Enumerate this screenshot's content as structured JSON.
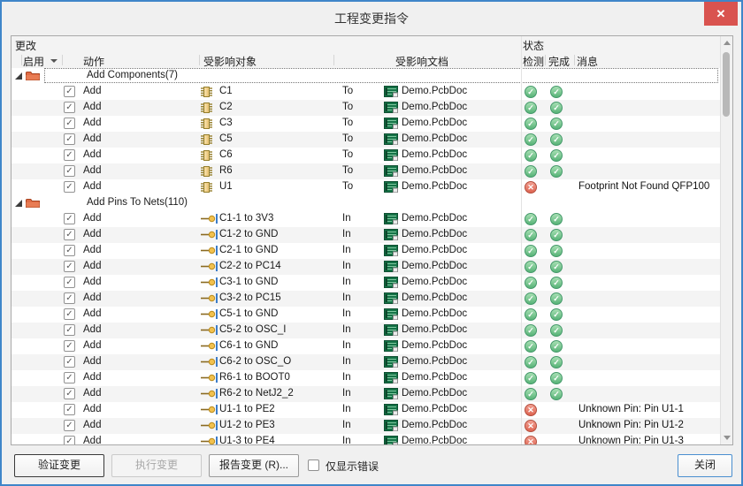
{
  "dialog": {
    "title": "工程变更指令"
  },
  "titlebar": {
    "close_glyph": "✕"
  },
  "symbols": {
    "ok": "✓",
    "error": "✕",
    "checkbox_check": "✓"
  },
  "colors": {
    "accent_border": "#3f86c9",
    "close_red": "#d9534f",
    "ok_green": "#57b377",
    "error_red": "#de6451",
    "folder_orange": "#e06a44",
    "chip_yellow": "#ecc97f",
    "doc_green": "#157347"
  },
  "table": {
    "band_changes": "更改",
    "band_status": "状态",
    "col_enable": "启用",
    "col_action": "动作",
    "col_object": "受影响对象",
    "col_document": "受影响文档",
    "col_check": "检测",
    "col_done": "完成",
    "col_message": "消息",
    "groups": [
      {
        "label": "Add Components(7)",
        "focused": true,
        "icon": "component",
        "rows": [
          {
            "enabled": true,
            "action": "Add",
            "object": "C1",
            "prep": "To",
            "doc": "Demo.PcbDoc",
            "check": "ok",
            "done": "ok",
            "message": ""
          },
          {
            "enabled": true,
            "action": "Add",
            "object": "C2",
            "prep": "To",
            "doc": "Demo.PcbDoc",
            "check": "ok",
            "done": "ok",
            "message": ""
          },
          {
            "enabled": true,
            "action": "Add",
            "object": "C3",
            "prep": "To",
            "doc": "Demo.PcbDoc",
            "check": "ok",
            "done": "ok",
            "message": ""
          },
          {
            "enabled": true,
            "action": "Add",
            "object": "C5",
            "prep": "To",
            "doc": "Demo.PcbDoc",
            "check": "ok",
            "done": "ok",
            "message": ""
          },
          {
            "enabled": true,
            "action": "Add",
            "object": "C6",
            "prep": "To",
            "doc": "Demo.PcbDoc",
            "check": "ok",
            "done": "ok",
            "message": ""
          },
          {
            "enabled": true,
            "action": "Add",
            "object": "R6",
            "prep": "To",
            "doc": "Demo.PcbDoc",
            "check": "ok",
            "done": "ok",
            "message": ""
          },
          {
            "enabled": true,
            "action": "Add",
            "object": "U1",
            "prep": "To",
            "doc": "Demo.PcbDoc",
            "check": "error",
            "done": "none",
            "message": "Footprint Not Found QFP100"
          }
        ]
      },
      {
        "label": "Add Pins To Nets(110)",
        "focused": false,
        "icon": "pin",
        "rows": [
          {
            "enabled": true,
            "action": "Add",
            "object": "C1-1 to 3V3",
            "prep": "In",
            "doc": "Demo.PcbDoc",
            "check": "ok",
            "done": "ok",
            "message": ""
          },
          {
            "enabled": true,
            "action": "Add",
            "object": "C1-2 to GND",
            "prep": "In",
            "doc": "Demo.PcbDoc",
            "check": "ok",
            "done": "ok",
            "message": ""
          },
          {
            "enabled": true,
            "action": "Add",
            "object": "C2-1 to GND",
            "prep": "In",
            "doc": "Demo.PcbDoc",
            "check": "ok",
            "done": "ok",
            "message": ""
          },
          {
            "enabled": true,
            "action": "Add",
            "object": "C2-2 to PC14",
            "prep": "In",
            "doc": "Demo.PcbDoc",
            "check": "ok",
            "done": "ok",
            "message": ""
          },
          {
            "enabled": true,
            "action": "Add",
            "object": "C3-1 to GND",
            "prep": "In",
            "doc": "Demo.PcbDoc",
            "check": "ok",
            "done": "ok",
            "message": ""
          },
          {
            "enabled": true,
            "action": "Add",
            "object": "C3-2 to PC15",
            "prep": "In",
            "doc": "Demo.PcbDoc",
            "check": "ok",
            "done": "ok",
            "message": ""
          },
          {
            "enabled": true,
            "action": "Add",
            "object": "C5-1 to GND",
            "prep": "In",
            "doc": "Demo.PcbDoc",
            "check": "ok",
            "done": "ok",
            "message": ""
          },
          {
            "enabled": true,
            "action": "Add",
            "object": "C5-2 to OSC_I",
            "prep": "In",
            "doc": "Demo.PcbDoc",
            "check": "ok",
            "done": "ok",
            "message": ""
          },
          {
            "enabled": true,
            "action": "Add",
            "object": "C6-1 to GND",
            "prep": "In",
            "doc": "Demo.PcbDoc",
            "check": "ok",
            "done": "ok",
            "message": ""
          },
          {
            "enabled": true,
            "action": "Add",
            "object": "C6-2 to OSC_O",
            "prep": "In",
            "doc": "Demo.PcbDoc",
            "check": "ok",
            "done": "ok",
            "message": ""
          },
          {
            "enabled": true,
            "action": "Add",
            "object": "R6-1 to BOOT0",
            "prep": "In",
            "doc": "Demo.PcbDoc",
            "check": "ok",
            "done": "ok",
            "message": ""
          },
          {
            "enabled": true,
            "action": "Add",
            "object": "R6-2 to NetJ2_2",
            "prep": "In",
            "doc": "Demo.PcbDoc",
            "check": "ok",
            "done": "ok",
            "message": ""
          },
          {
            "enabled": true,
            "action": "Add",
            "object": "U1-1 to PE2",
            "prep": "In",
            "doc": "Demo.PcbDoc",
            "check": "error",
            "done": "none",
            "message": "Unknown Pin: Pin U1-1"
          },
          {
            "enabled": true,
            "action": "Add",
            "object": "U1-2 to PE3",
            "prep": "In",
            "doc": "Demo.PcbDoc",
            "check": "error",
            "done": "none",
            "message": "Unknown Pin: Pin U1-2"
          },
          {
            "enabled": true,
            "action": "Add",
            "object": "U1-3 to PE4",
            "prep": "In",
            "doc": "Demo.PcbDoc",
            "check": "error",
            "done": "none",
            "message": "Unknown Pin: Pin U1-3"
          }
        ]
      }
    ]
  },
  "footer": {
    "validate_label": "验证变更",
    "execute_label": "执行变更",
    "report_label": "报告变更 (R)...",
    "only_errors_label": "仅显示错误",
    "close_label": "关闭"
  }
}
